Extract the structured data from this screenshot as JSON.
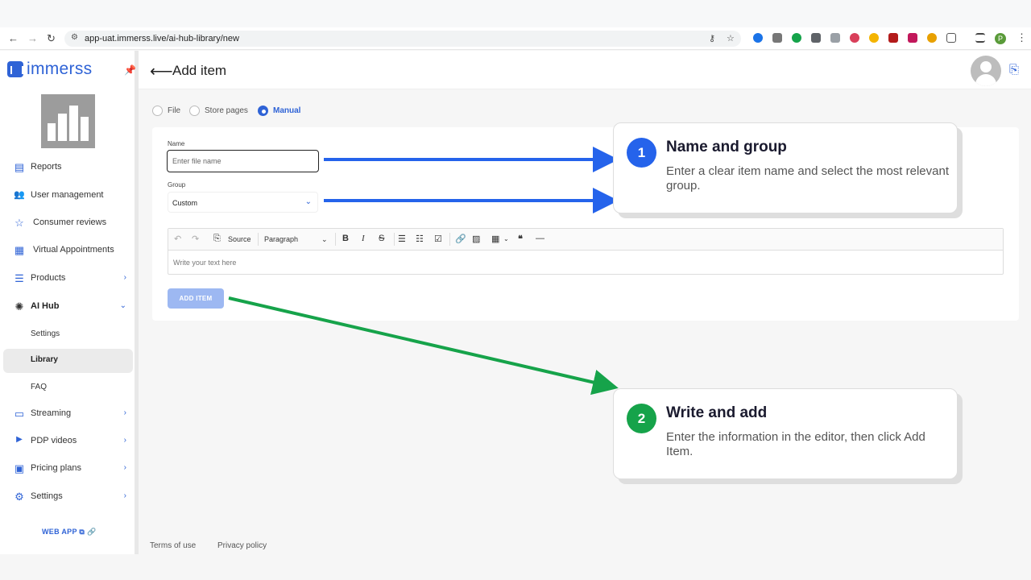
{
  "browser": {
    "url": "app-uat.immerss.live/ai-hub-library/new",
    "profile_initial": "P"
  },
  "app": {
    "logo_text": "immerss"
  },
  "sidebar": {
    "items": [
      {
        "label": "Reports",
        "icon": "reports-icon",
        "glyph": "▤"
      },
      {
        "label": "User management",
        "icon": "users-icon",
        "glyph": "👥"
      },
      {
        "label": "Consumer reviews",
        "icon": "star-icon",
        "glyph": "☆"
      },
      {
        "label": "Virtual Appointments",
        "icon": "calendar-icon",
        "glyph": "▦"
      },
      {
        "label": "Products",
        "icon": "list-icon",
        "glyph": "☰"
      },
      {
        "label": "AI Hub",
        "icon": "ai-icon",
        "glyph": "✺"
      },
      {
        "label": "Settings"
      },
      {
        "label": "Library"
      },
      {
        "label": "FAQ"
      },
      {
        "label": "Streaming",
        "icon": "monitor-icon",
        "glyph": "▭"
      },
      {
        "label": "PDP videos",
        "icon": "video-icon",
        "glyph": "▶"
      },
      {
        "label": "Pricing plans",
        "icon": "pricing-icon",
        "glyph": "▣"
      },
      {
        "label": "Settings",
        "icon": "gear-icon",
        "glyph": "⚙"
      }
    ],
    "web_app": "WEB APP"
  },
  "header": {
    "title": "Add item"
  },
  "source_options": [
    "File",
    "Store pages",
    "Manual"
  ],
  "source_selected": "Manual",
  "form": {
    "name_label": "Name",
    "name_placeholder": "Enter file name",
    "group_label": "Group",
    "group_value": "Custom",
    "editor": {
      "source_label": "Source",
      "paragraph_label": "Paragraph",
      "placeholder": "Write your text here"
    },
    "submit_label": "ADD ITEM"
  },
  "callouts": [
    {
      "number": "1",
      "title": "Name and group",
      "body": "Enter a clear item name and select the most relevant group.",
      "color": "#2563eb"
    },
    {
      "number": "2",
      "title": "Write and add",
      "body": "Enter the information in the editor, then click Add Item.",
      "color": "#16a34a"
    }
  ],
  "footer": {
    "terms": "Terms of use",
    "privacy": "Privacy policy"
  },
  "colors": {
    "accent": "#2f63d6",
    "arrow_blue": "#2563eb",
    "arrow_green": "#16a34a"
  }
}
